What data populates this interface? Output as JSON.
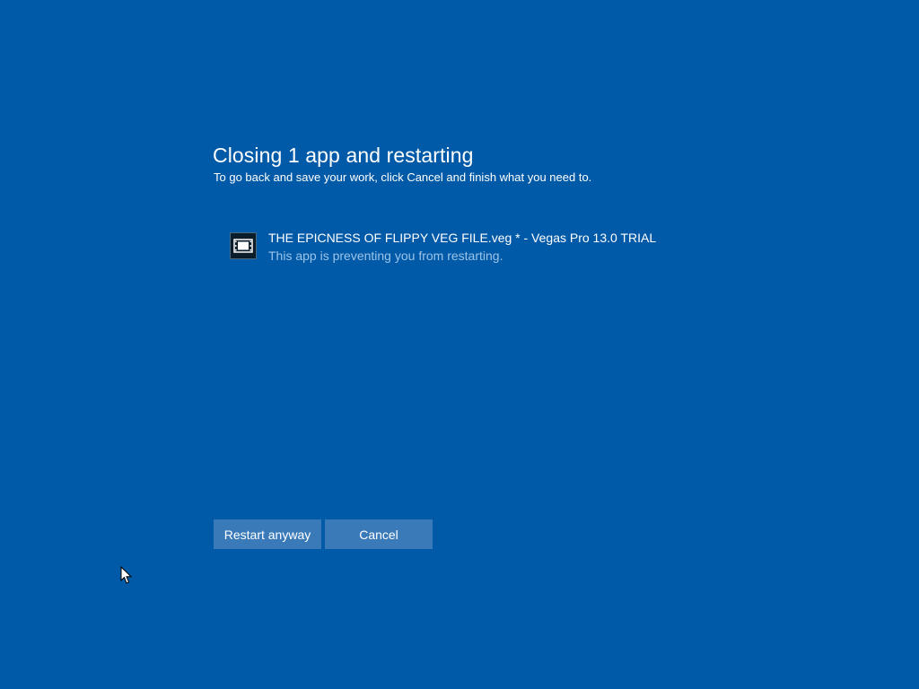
{
  "dialog": {
    "title": "Closing 1 app and restarting",
    "subtitle": "To go back and save your work, click Cancel and finish what you need to."
  },
  "apps": [
    {
      "name": "THE EPICNESS OF FLIPPY VEG FILE.veg * - Vegas Pro 13.0 TRIAL",
      "status": "This app is preventing you from restarting.",
      "icon": "film-strip-icon"
    }
  ],
  "buttons": {
    "restart_label": "Restart anyway",
    "cancel_label": "Cancel"
  },
  "colors": {
    "background": "#005aa7",
    "button": "#3a7ab8",
    "status_text": "#9cc4ea"
  }
}
